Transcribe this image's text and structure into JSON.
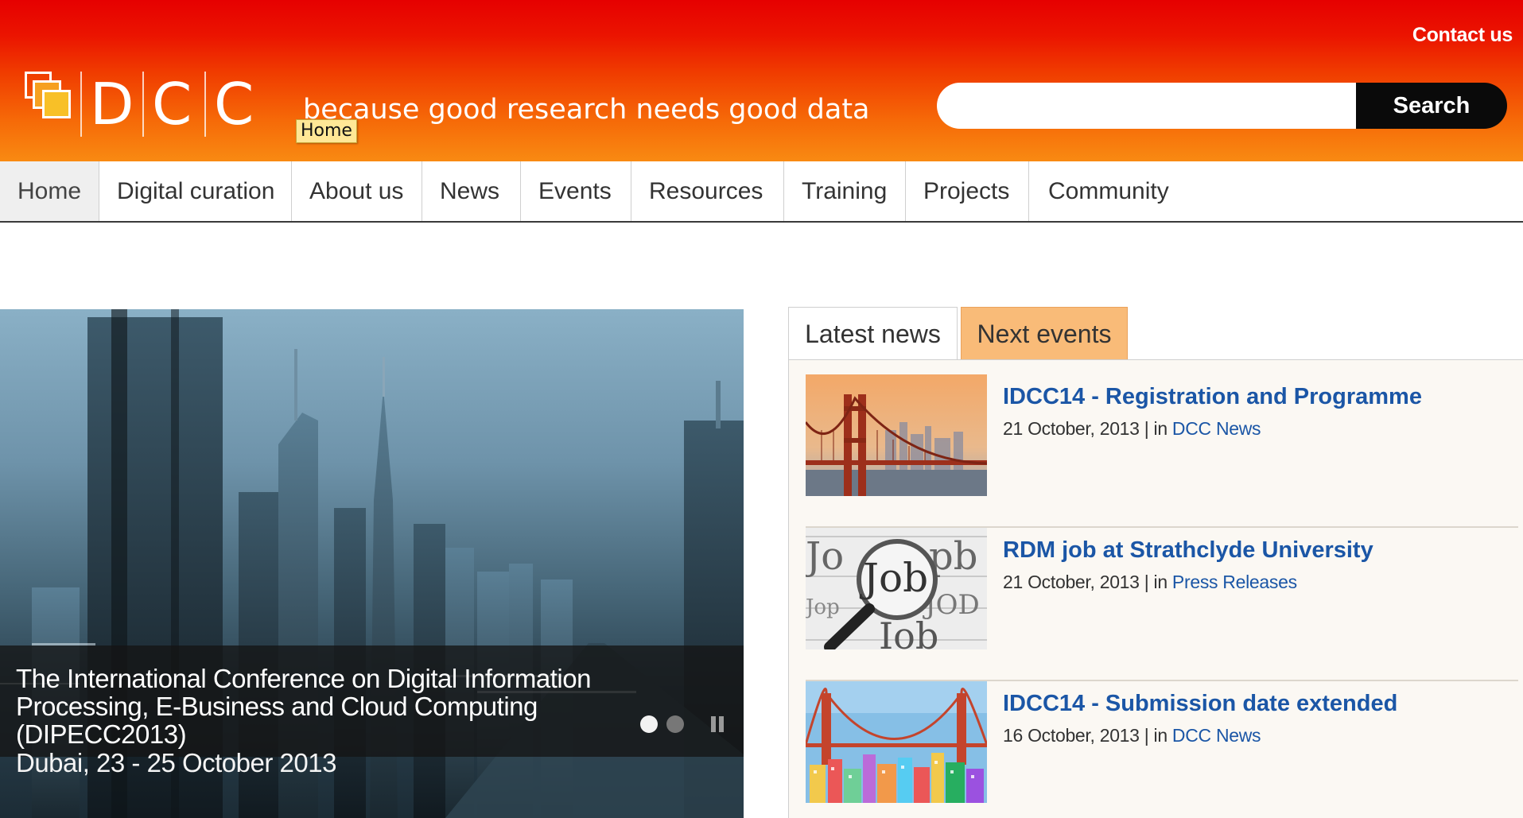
{
  "header": {
    "contact_label": "Contact us",
    "logo_letters": [
      "D",
      "C",
      "C"
    ],
    "tagline": "because good research needs good data",
    "tooltip": "Home",
    "search": {
      "placeholder": "",
      "button_label": "Search"
    }
  },
  "nav": {
    "items": [
      {
        "label": "Home"
      },
      {
        "label": "Digital curation"
      },
      {
        "label": "About us"
      },
      {
        "label": "News"
      },
      {
        "label": "Events"
      },
      {
        "label": "Resources"
      },
      {
        "label": "Training"
      },
      {
        "label": "Projects"
      },
      {
        "label": "Community"
      }
    ]
  },
  "slideshow": {
    "caption_title": "The International Conference on Digital Information Processing, E-Business and Cloud Computing (DIPECC2013)",
    "caption_sub": "Dubai, 23 - 25 October 2013"
  },
  "tabs": {
    "latest_label": "Latest news",
    "next_label": "Next events"
  },
  "news": [
    {
      "title": "IDCC14 - Registration and Programme",
      "date": "21 October, 2013 | in ",
      "category": "DCC News"
    },
    {
      "title": "RDM job at Strathclyde University",
      "date": "21 October, 2013 | in ",
      "category": "Press Releases"
    },
    {
      "title": "IDCC14 - Submission date extended",
      "date": "16 October, 2013 | in ",
      "category": "DCC News"
    }
  ],
  "thumb_words": {
    "job": "Job",
    "jo": "Jo",
    "pb": "pb",
    "jop": "Jop",
    "job2": "JOD",
    "iob": "Iob"
  },
  "colors": {
    "header_top": "#e60000",
    "header_bottom": "#f98a12",
    "link_blue": "#1b56a6",
    "tab_active": "#f9bb78"
  }
}
